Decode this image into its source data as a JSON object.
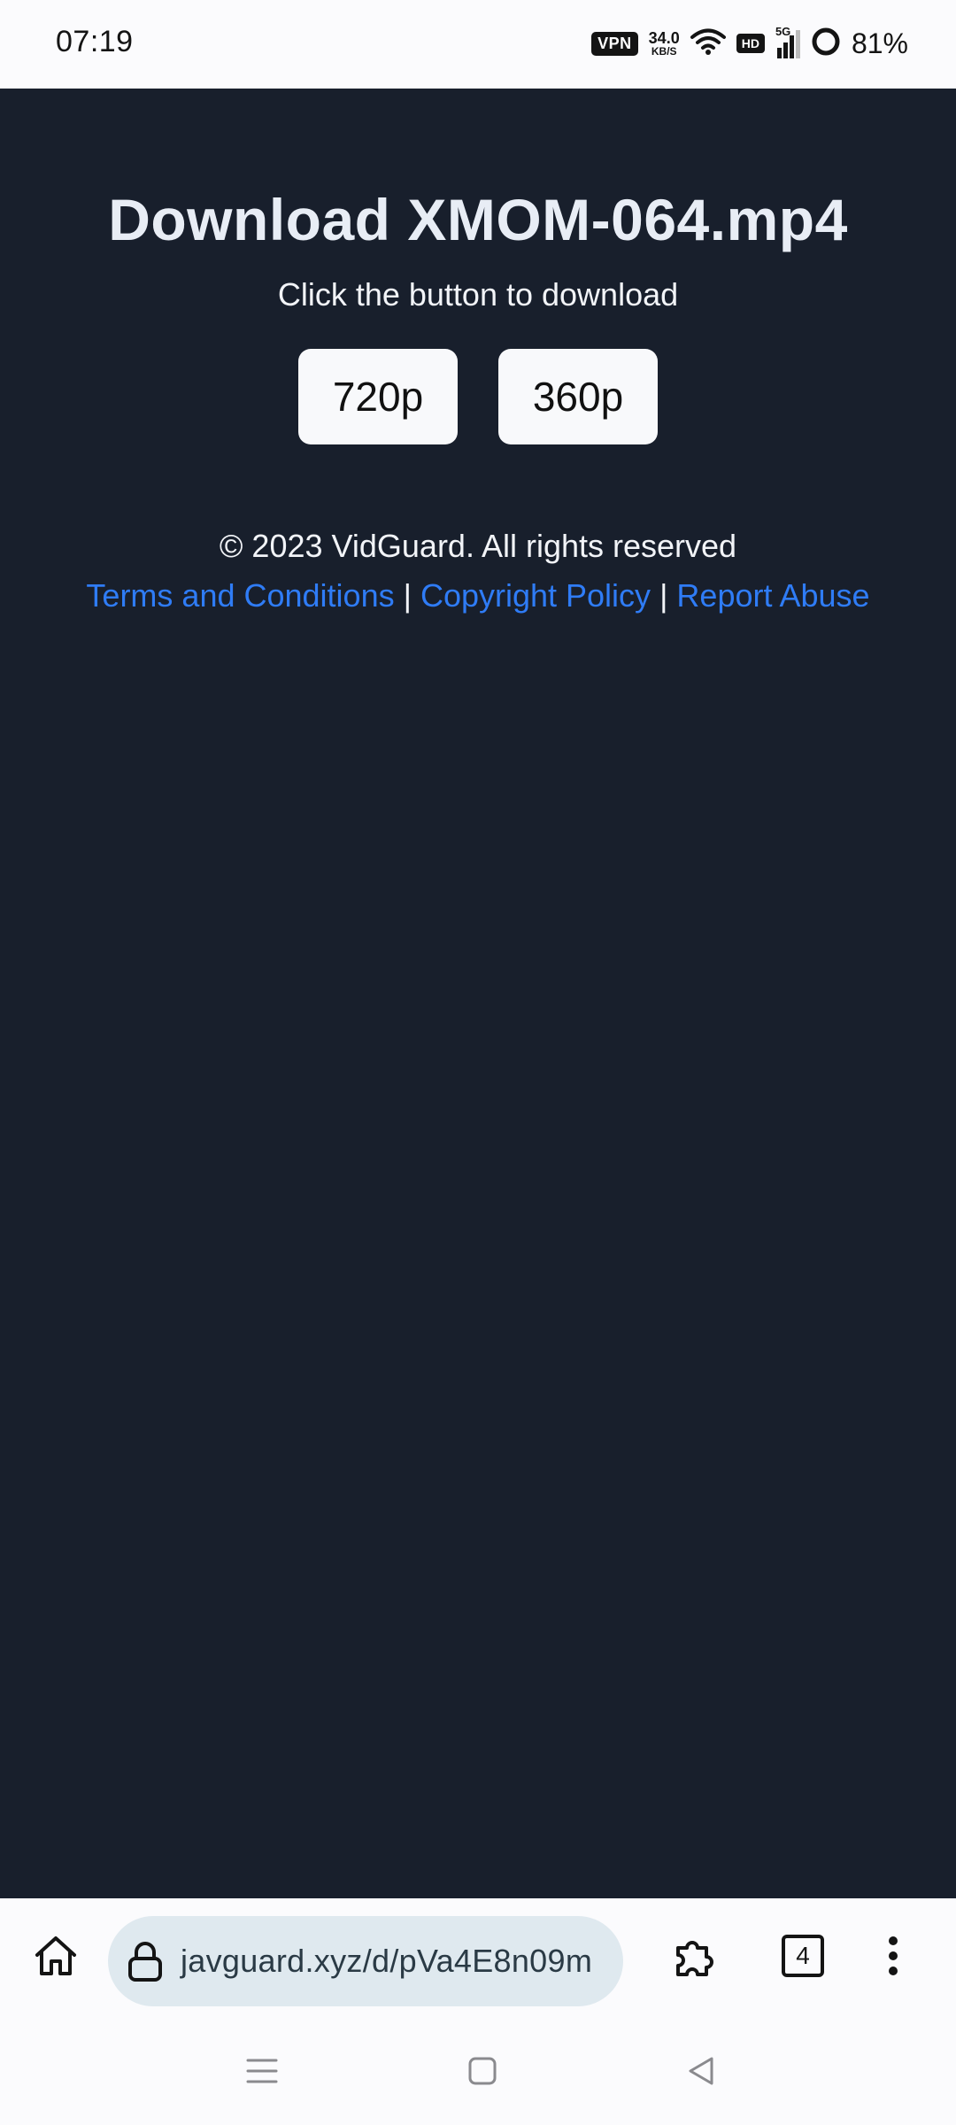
{
  "status_bar": {
    "time": "07:19",
    "vpn": "VPN",
    "net_speed_value": "34.0",
    "net_speed_unit": "KB/S",
    "hd": "HD",
    "network": "5G",
    "battery": "81%"
  },
  "page": {
    "title": "Download XMOM-064.mp4",
    "subtitle": "Click the button to download",
    "quality_buttons": [
      {
        "label": "720p"
      },
      {
        "label": "360p"
      }
    ],
    "copyright": "© 2023 VidGuard. All rights reserved",
    "footer_links": [
      {
        "label": "Terms and Conditions"
      },
      {
        "label": "Copyright Policy"
      },
      {
        "label": "Report Abuse"
      }
    ],
    "separator": "|"
  },
  "browser": {
    "url": "javguard.xyz/d/pVa4E8n09m",
    "tab_count": "4"
  },
  "colors": {
    "page_background": "#181f2c",
    "link": "#2f7cf6",
    "url_pill": "#dfe9ef"
  }
}
